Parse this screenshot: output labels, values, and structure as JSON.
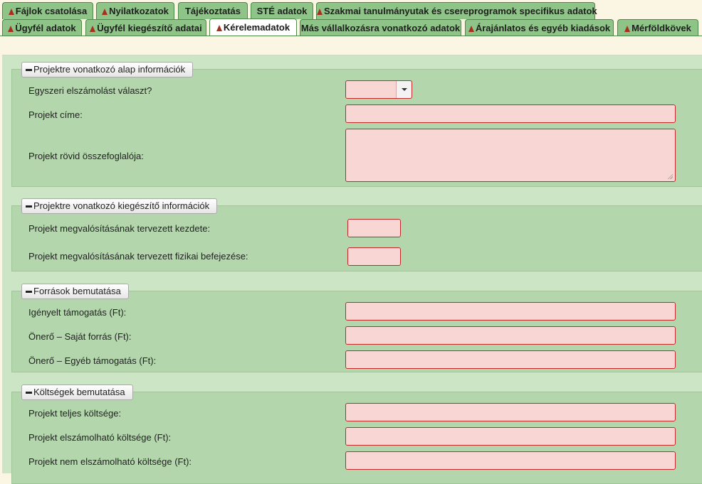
{
  "tabs_top": [
    {
      "label": "Fájlok csatolása",
      "warn": true
    },
    {
      "label": "Nyilatkozatok",
      "warn": true
    },
    {
      "label": "Tájékoztatás",
      "warn": false
    },
    {
      "label": "STÉ adatok",
      "warn": false
    },
    {
      "label": "Szakmai tanulmányutak és csereprogramok specifikus adatok",
      "warn": true
    }
  ],
  "tabs_bottom": [
    {
      "label": "Ügyfél adatok",
      "warn": true
    },
    {
      "label": "Ügyfél kiegészítő adatai",
      "warn": true
    },
    {
      "label": "Kérelemadatok",
      "warn": true,
      "active": true
    },
    {
      "label": "Más vállalkozásra vonatkozó adatok",
      "warn": false
    },
    {
      "label": "Árajánlatos és egyéb kiadások",
      "warn": true
    },
    {
      "label": "Mérföldkövek",
      "warn": true
    }
  ],
  "sections": [
    {
      "title": "Projektre vonatkozó alap információk",
      "fields": [
        {
          "label": "Egyszeri elszámolást választ?",
          "type": "select",
          "value": ""
        },
        {
          "label": "Projekt címe:",
          "type": "text",
          "value": ""
        },
        {
          "label": "Projekt rövid összefoglalója:",
          "type": "textarea",
          "value": ""
        }
      ]
    },
    {
      "title": "Projektre vonatkozó kiegészítő információk",
      "fields": [
        {
          "label": "Projekt megvalósításának tervezett kezdete:",
          "type": "date",
          "value": ""
        },
        {
          "label": "Projekt megvalósításának tervezett fizikai befejezése:",
          "type": "date",
          "value": ""
        }
      ]
    },
    {
      "title": "Források bemutatása",
      "fields": [
        {
          "label": "Igényelt támogatás (Ft):",
          "type": "text",
          "value": ""
        },
        {
          "label": "Önerő – Saját forrás (Ft):",
          "type": "text",
          "value": ""
        },
        {
          "label": "Önerő – Egyéb támogatás (Ft):",
          "type": "text",
          "value": ""
        }
      ]
    },
    {
      "title": "Költségek bemutatása",
      "fields": [
        {
          "label": "Projekt teljes költsége:",
          "type": "text",
          "value": ""
        },
        {
          "label": "Projekt elszámolható költsége (Ft):",
          "type": "text",
          "value": ""
        },
        {
          "label": "Projekt nem elszámolható költsége (Ft):",
          "type": "text",
          "value": ""
        }
      ]
    }
  ]
}
